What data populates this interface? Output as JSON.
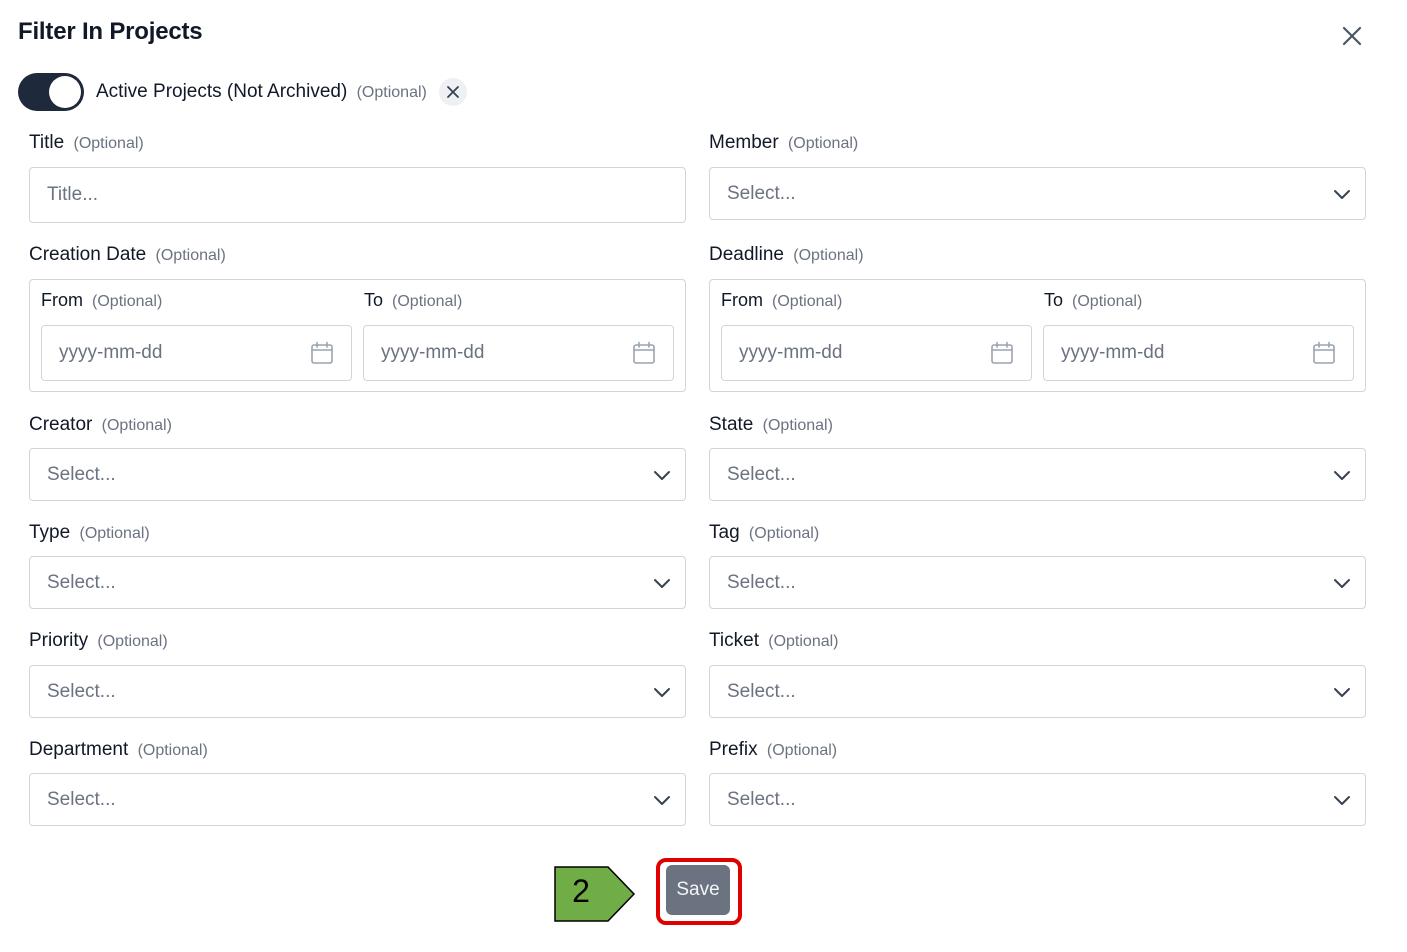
{
  "modal": {
    "title": "Filter In Projects"
  },
  "optional_text": "(Optional)",
  "toggle": {
    "label": "Active Projects (Not Archived)",
    "optional": "(Optional)",
    "checked": true
  },
  "title_field": {
    "label": "Title",
    "optional": "(Optional)",
    "placeholder": "Title..."
  },
  "member": {
    "label": "Member",
    "optional": "(Optional)",
    "placeholder": "Select..."
  },
  "creation_date": {
    "label": "Creation Date",
    "optional": "(Optional)",
    "from_label": "From",
    "to_label": "To",
    "from_placeholder": "yyyy-mm-dd",
    "to_placeholder": "yyyy-mm-dd"
  },
  "deadline": {
    "label": "Deadline",
    "optional": "(Optional)",
    "from_label": "From",
    "to_label": "To",
    "from_placeholder": "yyyy-mm-dd",
    "to_placeholder": "yyyy-mm-dd"
  },
  "creator": {
    "label": "Creator",
    "optional": "(Optional)",
    "placeholder": "Select..."
  },
  "state": {
    "label": "State",
    "optional": "(Optional)",
    "placeholder": "Select..."
  },
  "type": {
    "label": "Type",
    "optional": "(Optional)",
    "placeholder": "Select..."
  },
  "tag": {
    "label": "Tag",
    "optional": "(Optional)",
    "placeholder": "Select..."
  },
  "priority": {
    "label": "Priority",
    "optional": "(Optional)",
    "placeholder": "Select..."
  },
  "ticket": {
    "label": "Ticket",
    "optional": "(Optional)",
    "placeholder": "Select..."
  },
  "department": {
    "label": "Department",
    "optional": "(Optional)",
    "placeholder": "Select..."
  },
  "prefix": {
    "label": "Prefix",
    "optional": "(Optional)",
    "placeholder": "Select..."
  },
  "save_button": {
    "label": "Save"
  },
  "annotation": {
    "step_number": "2"
  },
  "colors": {
    "toggle_on": "#1e293b",
    "save_bg": "#6b7280",
    "highlight_border": "#e00000",
    "step_arrow": "#70ad47"
  },
  "icons": {
    "close": "close-icon",
    "clear": "x-icon",
    "chevron": "chevron-down-icon",
    "calendar": "calendar-icon"
  }
}
